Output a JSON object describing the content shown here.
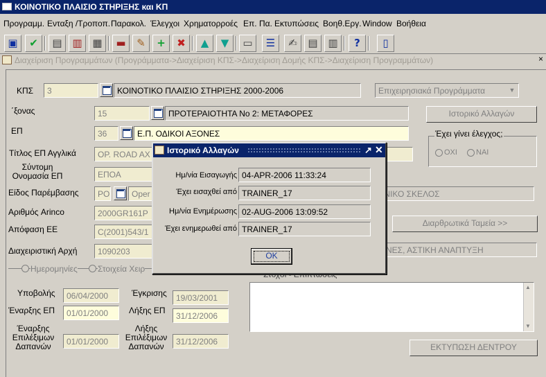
{
  "window": {
    "title": "ΚΟΙΝΟΤΙΚΟ ΠΛΑΙΣΙΟ ΣΤΗΡΙΞΗΣ και ΚΠ"
  },
  "menu": [
    "Προγραμμ.",
    "Ενταξη /Τροποπ.",
    "Παρακολ.",
    "Έλεγχοι",
    "Χρηματορροές",
    "Επ. Πα.",
    "Εκτυπώσεις",
    "Βοηθ.Εργ.",
    "Window",
    "Βοήθεια"
  ],
  "toolbar": {
    "buttons": [
      {
        "name": "save-icon",
        "glyph": "▣",
        "color": "#1030a0"
      },
      {
        "name": "accept-check-icon",
        "glyph": "✔",
        "color": "#10a030"
      },
      {
        "name": "enter-query-icon",
        "glyph": "▤",
        "color": "#404040"
      },
      {
        "name": "cancel-query-icon",
        "glyph": "▥",
        "color": "#a02020"
      },
      {
        "name": "execute-query-icon",
        "glyph": "▦",
        "color": "#404040"
      },
      {
        "name": "clear-record-icon",
        "glyph": "▬",
        "color": "#a02020"
      },
      {
        "name": "edit-icon",
        "glyph": "✎",
        "color": "#a06020"
      },
      {
        "name": "insert-record-icon",
        "glyph": "+",
        "color": "#10a030"
      },
      {
        "name": "delete-record-icon",
        "glyph": "✖",
        "color": "#c02020"
      },
      {
        "name": "previous-record-icon",
        "glyph": "▲",
        "color": "#10a090"
      },
      {
        "name": "next-record-icon",
        "glyph": "▼",
        "color": "#10a090"
      },
      {
        "name": "print-icon",
        "glyph": "▭",
        "color": "#404040"
      },
      {
        "name": "list-of-values-icon",
        "glyph": "☰",
        "color": "#1030a0"
      },
      {
        "name": "notes-icon",
        "glyph": "✍",
        "color": "#404040"
      },
      {
        "name": "document-icon",
        "glyph": "▤",
        "color": "#404040"
      },
      {
        "name": "clipboard-icon",
        "glyph": "▥",
        "color": "#404040"
      },
      {
        "name": "help-icon",
        "glyph": "?",
        "color": "#1030a0"
      },
      {
        "name": "exit-door-icon",
        "glyph": "▯",
        "color": "#1030a0"
      }
    ]
  },
  "subwindow": {
    "title": "Διαχείριση Προγραμμάτων (Προγράμματα->Διαχείριση ΚΠΣ->Διαχείριση Δομής ΚΠΣ->Διαχείριση Προγραμμάτων)",
    "close_glyph": "×"
  },
  "form": {
    "kps_label": "ΚΠΣ",
    "kps_code": "3",
    "kps_desc": "ΚΟΙΝΟΤΙΚΟ ΠΛΑΙΣΙΟ ΣΤΗΡΙΞΗΣ 2000-2006",
    "program_type": "Επιχειρησιακά Προγράμματα",
    "axis_label": "΄ξονας",
    "axis_code": "15",
    "axis_desc": "ΠΡΟΤΕΡΑΙΟΤΗΤΑ Νο 2: ΜΕΤΑΦΟΡΕΣ",
    "history_button": "Ιστορικό Αλλαγών",
    "ep_label": "ΕΠ",
    "ep_code": "36",
    "ep_desc": "Ε.Π. ΟΔΙΚΟΙ ΑΞΟΝΕΣ",
    "checked_label": "Έχει γίνει έλεγχος;",
    "radio_no": "ΟΧΙ",
    "radio_yes": "ΝΑΙ",
    "title_en_label": "Τίτλος ΕΠ Αγγλικά",
    "title_en": "OP. ROAD AX",
    "short_name_label": "Σύντομη Ονομασία ΕΠ",
    "short_name": "ΕΠΟΑ",
    "intervention_label": "Είδος Παρέμβασης",
    "intervention_code": "PO",
    "intervention_desc": "Oper",
    "intervention_right": "ΟΝΙΚΟ ΣΚΕΛΟΣ",
    "arinco_label": "Αριθμός Arinco",
    "arinco": "2000GR161P",
    "structural_funds_button": "Διαρθρωτικά Ταμεία >>",
    "decision_label": "Απόφαση ΕΕ",
    "decision": "C(2001)543/1",
    "authority_label": "Διαχειριστική Αρχή",
    "authority": "1090203",
    "authority_right": "ΝΕΣ, ΑΣΤΙΚΗ ΑΝΑΠΤΥΞΗ",
    "tab_dates": "Ημερομηνίες",
    "tab_data": "Στοιχεία Χειρ",
    "submission_label": "Υποβολής",
    "submission": "06/04/2000",
    "approval_label": "Έγκρισης",
    "approval": "19/03/2001",
    "start_label": "Έναρξης ΕΠ",
    "start": "01/01/2000",
    "end_label": "Λήξης ΕΠ",
    "end": "31/12/2006",
    "elig_start_label": "Έναρξης Επιλέξιμων Δαπανών",
    "elig_start": "01/01/2000",
    "elig_end_label": "Λήξης Επιλέξιμων Δαπανών",
    "elig_end": "31/12/2006",
    "notes_label": "Στόχοι - Επιπτώσεις",
    "print_tree_button": "ΕΚΤΥΠΩΣΗ ΔΕΝΤΡΟΥ"
  },
  "dialog": {
    "title": "Ιστορικό Αλλαγών",
    "max_glyph": "↗",
    "close_glyph": "✕",
    "entry_date_label": "Ημ/νία Εισαγωγής",
    "entry_date": "04-APR-2006 11:33:24",
    "entered_by_label": "Έχει εισαχθεί από",
    "entered_by": "TRAINER_17",
    "update_date_label": "Ημ/νία Ενημέρωσης",
    "update_date": "02-AUG-2006 13:09:52",
    "updated_by_label": "Έχει ενημερωθεί από",
    "updated_by": "TRAINER_17",
    "ok": "OK"
  }
}
